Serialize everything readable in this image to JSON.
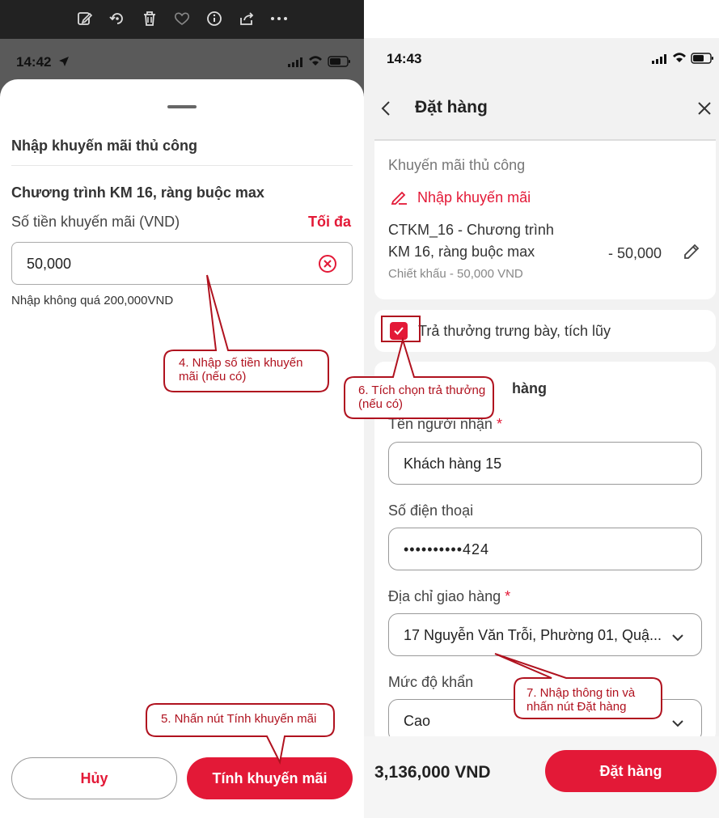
{
  "left": {
    "time": "14:42",
    "sheet_title": "Nhập khuyến mãi thủ công",
    "program_title": "Chương trình KM 16, ràng buộc max",
    "amount_label": "Số tiền khuyến mãi (VND)",
    "max_link": "Tối đa",
    "amount_value": "50,000",
    "hint": "Nhập không quá 200,000VND",
    "cancel_label": "Hủy",
    "calc_label": "Tính khuyến mãi"
  },
  "right": {
    "time": "14:43",
    "title": "Đặt hàng",
    "promo_section_label": "Khuyến mãi thủ công",
    "enter_promo_link": "Nhập khuyến mãi",
    "promo_name_line1": "CTKM_16 - Chương trình",
    "promo_name_line2": "KM 16, ràng buộc max",
    "promo_amount": "- 50,000",
    "promo_discount": "Chiết khấu - 50,000 VND",
    "reward_checkbox_label": "Trả thưởng trưng bày, tích lũy",
    "section_partial": "hàng",
    "recipient_label": "Tên người nhận",
    "recipient_value": "Khách hàng 15",
    "phone_label": "Số điện thoại",
    "phone_value": "••••••••••424",
    "address_label": "Địa chỉ giao hàng",
    "address_value": "17 Nguyễn Văn Trỗi, Phường 01, Quậ...",
    "urgency_label": "Mức độ khẩn",
    "urgency_value": "Cao",
    "total": "3,136,000 VND",
    "order_label": "Đặt hàng",
    "required_mark": "*"
  },
  "callouts": {
    "c4": "4. Nhập số tiền khuyến mãi (nếu có)",
    "c5": "5. Nhấn nút Tính khuyến mãi",
    "c6": "6. Tích chọn trả thưởng (nếu có)",
    "c7": "7. Nhập thông tin và nhấn nút Đặt hàng"
  },
  "colors": {
    "accent": "#e31937",
    "callout": "#b0121f"
  },
  "icons": [
    "edit-icon",
    "rotate-icon",
    "trash-icon",
    "heart-icon",
    "info-icon",
    "share-icon",
    "more-icon",
    "back-icon",
    "close-icon",
    "pencil-icon",
    "clear-icon",
    "chevron-down-icon",
    "location-arrow-icon",
    "signal-icon",
    "wifi-icon",
    "battery-icon"
  ]
}
